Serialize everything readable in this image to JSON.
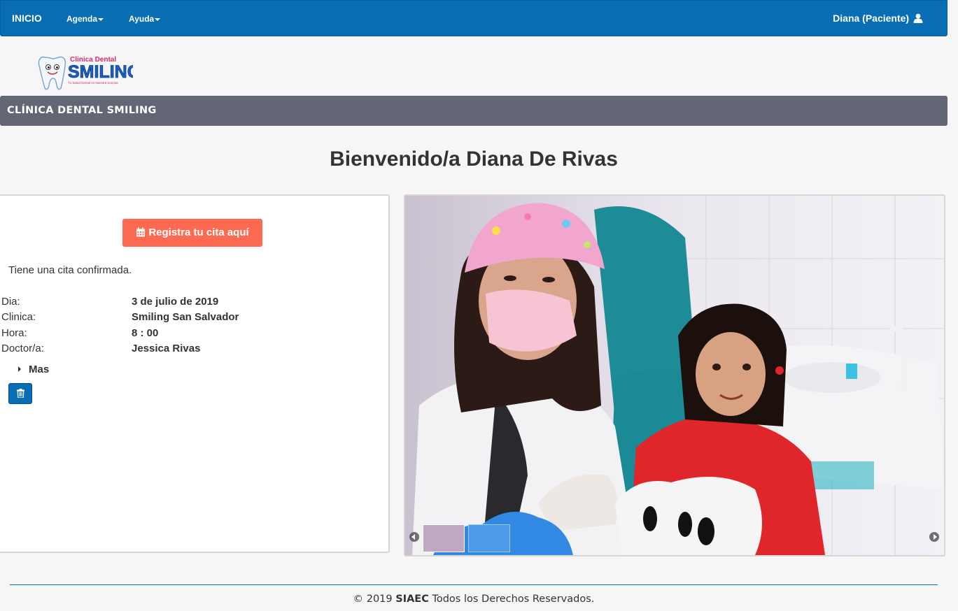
{
  "nav": {
    "brand": "INICIO",
    "menu": [
      {
        "label": "Agenda"
      },
      {
        "label": "Ayuda"
      }
    ],
    "user": "Diana (Paciente)"
  },
  "logo": {
    "name": "Clinica Dental",
    "brand": "SMILING",
    "tagline": "Tu Salud Dental es Nuestra Sonrisa"
  },
  "section_title": "CLÍNICA DENTAL SMILING",
  "welcome": "Bienvenido/a Diana De Rivas",
  "cita": {
    "register_button": "Registra tu cita aquí",
    "status": "Tiene una cita confirmada.",
    "rows": [
      {
        "label": "Dia:",
        "value": "3 de julio de 2019"
      },
      {
        "label": "Clinica:",
        "value": "Smiling San Salvador"
      },
      {
        "label": "Hora:",
        "value": "8 : 00"
      },
      {
        "label": "Doctor/a:",
        "value": "Jessica Rivas"
      }
    ],
    "more": "Mas"
  },
  "footer": {
    "prefix": "© 2019 ",
    "brand": "SIAEC",
    "suffix": " Todos los Derechos Reservados."
  },
  "colors": {
    "nav": "#086db2",
    "title_bar": "#636775",
    "cta": "#fc6a52"
  }
}
